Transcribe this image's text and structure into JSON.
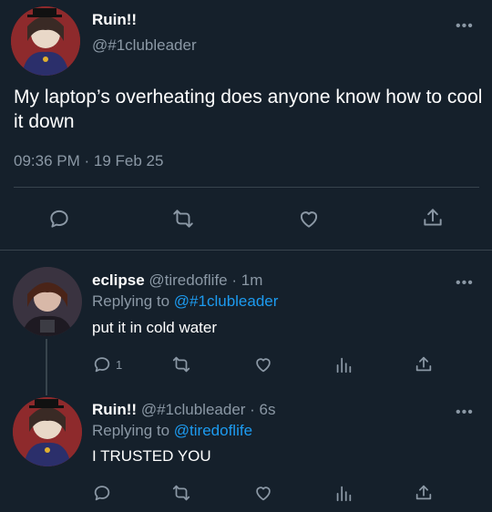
{
  "main_tweet": {
    "display_name": "Ruin!!",
    "handle": "@#1clubleader",
    "text": "My laptop’s overheating does anyone know how to cool it down",
    "timestamp": "09:36 PM · 19 Feb 25",
    "more": "•••"
  },
  "replies": [
    {
      "display_name": "eclipse",
      "handle": "@tiredoflife",
      "time": "· 1m",
      "replying_prefix": "Replying to",
      "replying_to": "@#1clubleader",
      "text": "put it in cold water",
      "reply_count": "1",
      "more": "•••"
    },
    {
      "display_name": "Ruin!!",
      "handle": "@#1clubleader",
      "time": "· 6s",
      "replying_prefix": "Replying to",
      "replying_to": "@tiredoflife",
      "text": "I TRUSTED YOU",
      "reply_count": "",
      "more": "•••"
    }
  ],
  "icons": [
    "reply-icon",
    "retweet-icon",
    "like-icon",
    "views-icon",
    "share-icon",
    "more-icon"
  ],
  "colors": {
    "background": "#15202b",
    "text": "#ffffff",
    "secondary": "#8b98a5",
    "link": "#1d9bf0",
    "divider": "#38444d"
  }
}
